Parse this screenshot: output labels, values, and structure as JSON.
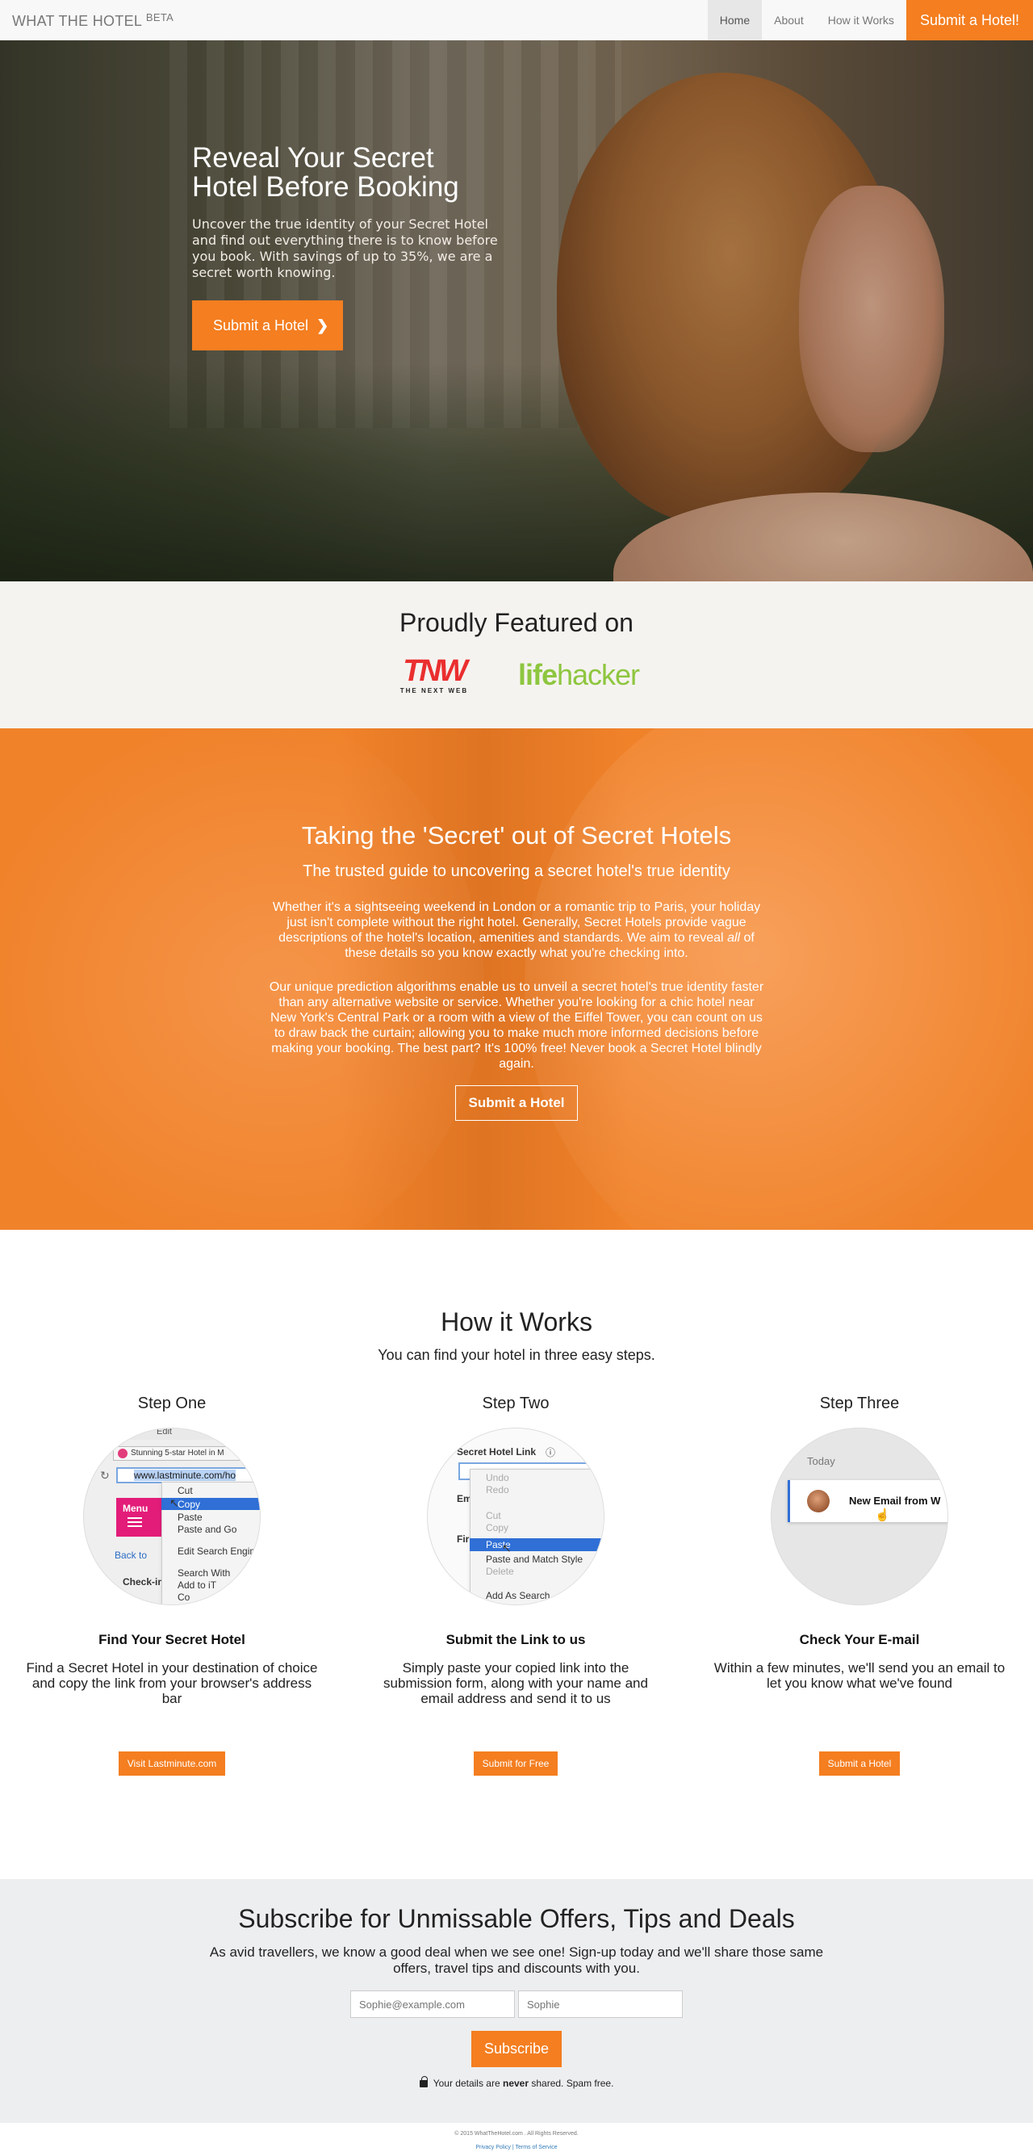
{
  "nav": {
    "brand": "WHAT THE HOTEL",
    "brand_badge": "BETA",
    "links": [
      "Home",
      "About",
      "How it Works"
    ],
    "active": "Home",
    "cta": "Submit a Hotel!"
  },
  "hero": {
    "title_line1": "Reveal Your Secret",
    "title_line2": "Hotel Before Booking",
    "subtitle": "Uncover the true identity of your Secret Hotel and find out everything there is to know before you book. With savings of up to 35%, we are a secret worth knowing.",
    "button": "Submit a Hotel",
    "button_icon": "chevron-right-icon"
  },
  "featured": {
    "title": "Proudly Featured on",
    "tnw_mark": "TNW",
    "tnw_sub": "THE NEXT WEB",
    "lifehacker_a": "life",
    "lifehacker_b": "hacker"
  },
  "secret": {
    "title": "Taking the 'Secret' out of Secret Hotels",
    "lead": "The trusted guide to uncovering a secret hotel's true identity",
    "p1_a": "Whether it's a sightseeing weekend in London or a romantic trip to Paris, your holiday just isn't complete without the right hotel. Generally, Secret Hotels provide vague descriptions of the hotel's location, amenities and standards. We aim to reveal",
    "p1_em": "all",
    "p1_b": "of these details so you know exactly what you're checking into.",
    "p2": "Our unique prediction algorithms enable us to unveil a secret hotel's true identity faster than any alternative website or service. Whether you're looking for a chic hotel near New York's Central Park or a room with a view of the Eiffel Tower, you can count on us to draw back the curtain; allowing you to make much more informed decisions before making your booking. The best part? It's 100% free! Never book a Secret Hotel blindly again.",
    "button": "Submit a Hotel"
  },
  "how": {
    "title": "How it Works",
    "subtitle": "You can find your hotel in three easy steps.",
    "steps": [
      {
        "name": "Step One",
        "heading": "Find Your Secret Hotel",
        "text": "Find a Secret Hotel in your destination of choice and copy the link from your browser's address bar",
        "button": "Visit Lastminute.com",
        "mock": {
          "edit": "Edit",
          "tab": "Stunning 5-star Hotel in M",
          "url": "www.lastminute.com/ho",
          "menu": "Menu",
          "back": "Back to",
          "checkin": "Check-in",
          "items": [
            "Cut",
            "Copy",
            "Paste",
            "Paste and Go",
            "Edit Search Engines",
            "Search With",
            "Add to iT",
            "Co"
          ]
        }
      },
      {
        "name": "Step Two",
        "heading": "Submit the Link to us",
        "text": "Simply paste your copied link into the submission form, along with your name and email address and send it to us",
        "button": "Submit for Free",
        "mock": {
          "label": "Secret Hotel Link",
          "field_em": "Em",
          "field_fir": "Fir",
          "items": [
            "Undo",
            "Redo",
            "Cut",
            "Copy",
            "Paste",
            "Paste and Match Style",
            "Delete",
            "Add As Search"
          ]
        }
      },
      {
        "name": "Step Three",
        "heading": "Check Your E-mail",
        "text": "Within a few minutes, we'll send you an email to let you know what we've found",
        "button": "Submit a Hotel",
        "mock": {
          "today": "Today",
          "notification": "New Email from W"
        }
      }
    ]
  },
  "subscribe": {
    "title": "Subscribe for Unmissable Offers, Tips and Deals",
    "text": "As avid travellers, we know a good deal when we see one! Sign-up today and we'll share those same offers, travel tips and discounts with you.",
    "email_placeholder": "Sophie@example.com",
    "name_placeholder": "Sophie",
    "button": "Subscribe",
    "privacy_a": "Your details are",
    "privacy_em": "never",
    "privacy_b": "shared. Spam free."
  },
  "footer": {
    "copyright": "© 2015 WhatTheHotel.com . All Rights Reserved.",
    "links": "Privacy Policy | Terms of Service"
  },
  "colors": {
    "accent": "#f47e20",
    "navbar": "#f8f8f8",
    "featured_bg": "#f5f3f0",
    "subscribe_bg": "#edeef0"
  }
}
